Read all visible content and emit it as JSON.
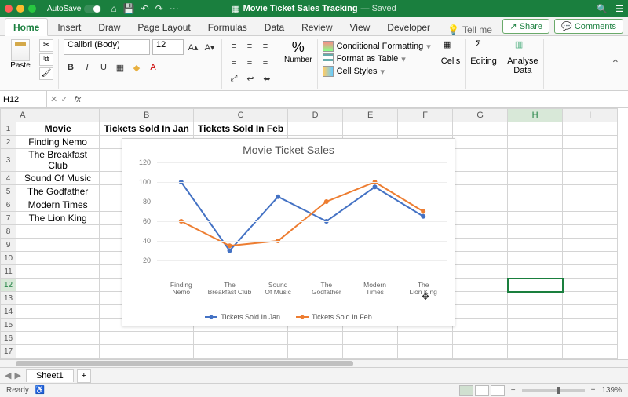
{
  "titlebar": {
    "autosave": "AutoSave",
    "doc_icon": "x",
    "doc_name": "Movie Ticket Sales Tracking",
    "doc_status": "— Saved"
  },
  "tabs": [
    "Home",
    "Insert",
    "Draw",
    "Page Layout",
    "Formulas",
    "Data",
    "Review",
    "View",
    "Developer"
  ],
  "tellme": "Tell me",
  "share": "Share",
  "comments": "Comments",
  "ribbon": {
    "paste": "Paste",
    "font_name": "Calibri (Body)",
    "font_size": "12",
    "number": "Number",
    "cond_fmt": "Conditional Formatting",
    "fmt_table": "Format as Table",
    "cell_styles": "Cell Styles",
    "cells": "Cells",
    "editing": "Editing",
    "analyse": "Analyse Data"
  },
  "namebox": "H12",
  "columns": [
    "A",
    "B",
    "C",
    "D",
    "E",
    "F",
    "G",
    "H",
    "I"
  ],
  "header_row": [
    "Movie",
    "Tickets Sold In Jan",
    "Tickets Sold In Feb"
  ],
  "data_rows": [
    [
      "Finding Nemo",
      "100",
      "60"
    ],
    [
      "The Breakfast Club",
      "30",
      "35"
    ],
    [
      "Sound Of Music",
      "",
      ""
    ],
    [
      "The Godfather",
      "",
      ""
    ],
    [
      "Modern Times",
      "",
      ""
    ],
    [
      "The Lion King",
      "",
      ""
    ]
  ],
  "selected_cell": "H12",
  "chart_data": {
    "type": "line",
    "title": "Movie Ticket Sales",
    "categories": [
      "Finding Nemo",
      "The Breakfast Club",
      "Sound Of Music",
      "The Godfather",
      "Modern Times",
      "The Lion King"
    ],
    "series": [
      {
        "name": "Tickets Sold In Jan",
        "color": "#4472c4",
        "values": [
          100,
          30,
          85,
          60,
          95,
          65
        ]
      },
      {
        "name": "Tickets Sold In Feb",
        "color": "#ed7d31",
        "values": [
          60,
          35,
          40,
          80,
          100,
          70
        ]
      }
    ],
    "ylim": [
      0,
      120
    ],
    "yticks": [
      20,
      40,
      60,
      80,
      100,
      120
    ]
  },
  "sheet_tab": "Sheet1",
  "status": "Ready",
  "zoom": "139%"
}
